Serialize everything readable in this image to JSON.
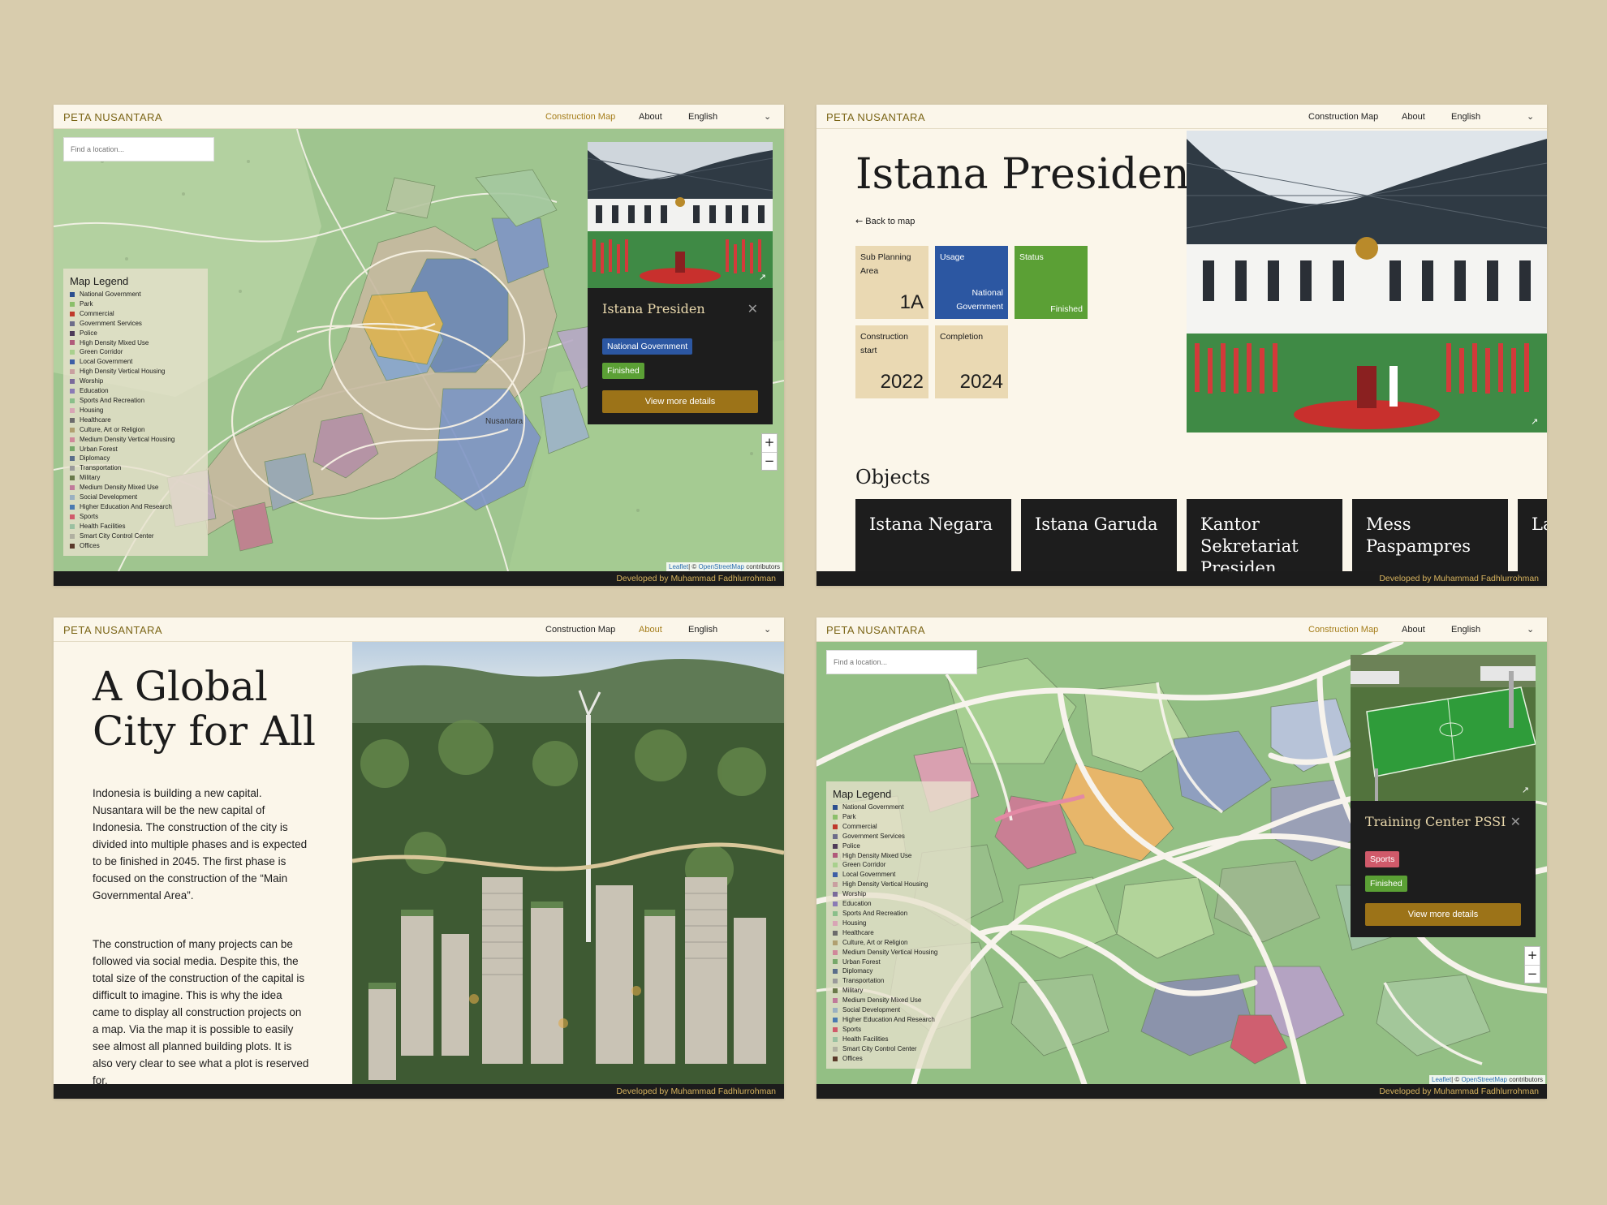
{
  "brand": "PETA NUSANTARA",
  "nav": {
    "construction_map": "Construction Map",
    "about": "About",
    "language": "English"
  },
  "footer": "Developed by Muhammad Fadhlurrohman",
  "search_placeholder": "Find a location...",
  "legend": {
    "title": "Map Legend",
    "items": [
      {
        "label": "National Government",
        "color": "#2b4f8f"
      },
      {
        "label": "Park",
        "color": "#8bbf6a"
      },
      {
        "label": "Commercial",
        "color": "#c0392b"
      },
      {
        "label": "Government Services",
        "color": "#6d6d8a"
      },
      {
        "label": "Police",
        "color": "#4e3b59"
      },
      {
        "label": "High Density Mixed Use",
        "color": "#b05a7a"
      },
      {
        "label": "Green Corridor",
        "color": "#a8d08d"
      },
      {
        "label": "Local Government",
        "color": "#3d5fa6"
      },
      {
        "label": "High Density Vertical Housing",
        "color": "#c9a0a0"
      },
      {
        "label": "Worship",
        "color": "#7a6a9a"
      },
      {
        "label": "Education",
        "color": "#8a7bb5"
      },
      {
        "label": "Sports And Recreation",
        "color": "#8abf8a"
      },
      {
        "label": "Housing",
        "color": "#d8a5b5"
      },
      {
        "label": "Healthcare",
        "color": "#6b6b6b"
      },
      {
        "label": "Culture, Art or Religion",
        "color": "#b0a070"
      },
      {
        "label": "Medium Density Vertical Housing",
        "color": "#d0889a"
      },
      {
        "label": "Urban Forest",
        "color": "#77a86a"
      },
      {
        "label": "Diplomacy",
        "color": "#5a6e8a"
      },
      {
        "label": "Transportation",
        "color": "#9a9a9a"
      },
      {
        "label": "Military",
        "color": "#6a7a4a"
      },
      {
        "label": "Medium Density Mixed Use",
        "color": "#c07a9a"
      },
      {
        "label": "Social Development",
        "color": "#9ab0c0"
      },
      {
        "label": "Higher Education And Research",
        "color": "#4a7ab0"
      },
      {
        "label": "Sports",
        "color": "#d05a6a"
      },
      {
        "label": "Health Facilities",
        "color": "#9ac0a0"
      },
      {
        "label": "Smart City Control Center",
        "color": "#b0b0a0"
      },
      {
        "label": "Offices",
        "color": "#5a3a2a"
      }
    ]
  },
  "map": {
    "zoom_in": "+",
    "zoom_out": "−",
    "attribution_leaflet": "Leaflet",
    "attribution_rest": "| © ",
    "attribution_osm": "OpenStreetMap",
    "attribution_end": " contributors",
    "map_label": "Nusantara"
  },
  "popup1": {
    "title": "Istana Presiden",
    "usage": "National Government",
    "status": "Finished",
    "button": "View more details",
    "usage_color": "#2c57a2",
    "status_color": "#5ba035"
  },
  "popup2": {
    "title": "Training Center PSSI",
    "usage": "Sports",
    "status": "Finished",
    "button": "View more details",
    "usage_color": "#d05a6a",
    "status_color": "#5ba035"
  },
  "detail": {
    "title": "Istana Presiden",
    "back": "Back to map",
    "sub_planning_label": "Sub Planning Area",
    "sub_planning_value": "1A",
    "usage_label": "Usage",
    "usage_value": "National Government",
    "status_label": "Status",
    "status_value": "Finished",
    "construction_label": "Construction start",
    "construction_value": "2022",
    "completion_label": "Completion",
    "completion_value": "2024",
    "objects_title": "Objects",
    "objects": [
      "Istana Negara",
      "Istana Garuda",
      "Kantor Sekretariat Presiden",
      "Mess Paspampres",
      "La Up"
    ]
  },
  "about": {
    "title": "A Global City for All",
    "para1": "Indonesia is building a new capital. Nusantara will be the new capital of Indonesia. The construction of the city is divided into multiple phases and is expected to be finished in 2045. The first phase is focused on the construction of the “Main Governmental Area”.",
    "para2": "The construction of many projects can be followed via social media. Despite this, the total size of the construction of the capital is difficult to imagine. This is why the idea came to display all construction projects on a map. Via the map it is possible to easily see almost all planned building plots. It is also very clear to see what a plot is reserved for."
  },
  "icons": {
    "external_link": "external-link-icon",
    "close": "close-icon",
    "back": "arrow-left-icon",
    "chevron": "chevron-down-icon"
  }
}
